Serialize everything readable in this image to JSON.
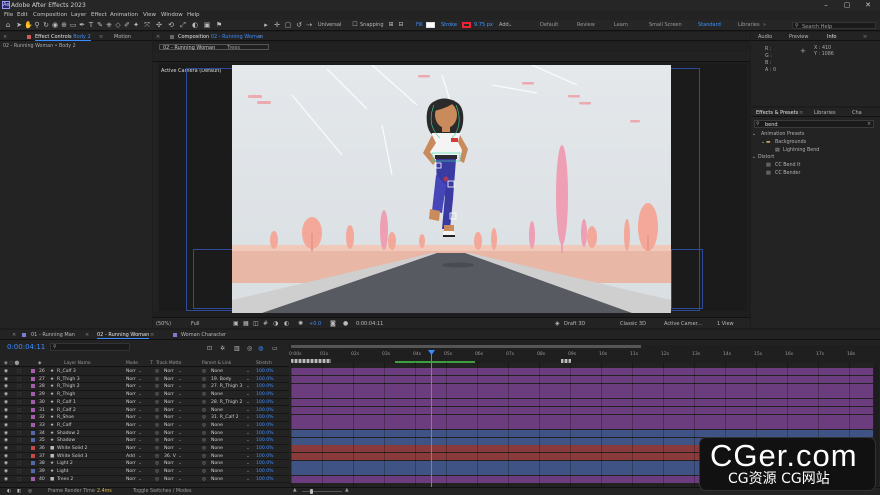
{
  "app": {
    "title": "Adobe After Effects 2023",
    "icon": "Ae"
  },
  "menu": [
    "File",
    "Edit",
    "Composition",
    "Layer",
    "Effect",
    "Animation",
    "View",
    "Window",
    "Help"
  ],
  "toolbar": {
    "universal": "Universal",
    "snapping": "Snapping",
    "fill": "Fill",
    "stroke": "Stroke",
    "stroke_width": "9.75 px",
    "add": "Add"
  },
  "workspaces": [
    "Default",
    "Review",
    "Learn",
    "Small Screen",
    "Standard",
    "Libraries"
  ],
  "search_help": "Search Help",
  "effect_controls": {
    "tab": "Effect Controls",
    "layer": "Body 2",
    "other_tab": "Motion",
    "subtitle": "02 - Running Woman • Body 2"
  },
  "composition_panel": {
    "tab": "Composition",
    "name": "02 - Running Woman",
    "breadcrumb_current": "02 - Running Woman",
    "breadcrumb_next": "Trees",
    "camera_label": "Active Camera (Default)",
    "zoom": "(50%)",
    "resolution": "Full",
    "exposure": "+0.0",
    "timecode": "0:00:04:11",
    "renderer": "Draft 3D",
    "renderer_mode": "Classic 3D",
    "camera_select": "Active Camer...",
    "views": "1 View"
  },
  "info_panel": {
    "tabs": [
      "Audio",
      "Preview",
      "Info"
    ],
    "r": "R :",
    "g": "G :",
    "b": "B :",
    "a": "A : 0",
    "x": "X : 410",
    "y": "Y : 1086"
  },
  "effects_panel": {
    "tabs": [
      "Effects & Presets",
      "Libraries",
      "Cha"
    ],
    "search": "bend",
    "items": [
      {
        "label": "Animation Presets",
        "indent": 0
      },
      {
        "label": "Backgrounds",
        "indent": 1
      },
      {
        "label": "Lightning Bend",
        "indent": 2
      },
      {
        "label": "Distort",
        "indent": 0
      },
      {
        "label": "CC Bend It",
        "indent": 1
      },
      {
        "label": "CC Bender",
        "indent": 1
      }
    ]
  },
  "timeline": {
    "tabs": [
      "01 - Running Man",
      "02 - Running Woman",
      "Woman Character"
    ],
    "timecode": "0:00:04:11",
    "headers": {
      "layer_name": "Layer Name",
      "mode": "Mode",
      "t": "T",
      "track_matte": "Track Matte",
      "parent": "Parent & Link",
      "stretch": "Stretch"
    },
    "ruler": [
      "0:00s",
      "01s",
      "02s",
      "03s",
      "04s",
      "05s",
      "06s",
      "07s",
      "08s",
      "09s",
      "10s",
      "11s",
      "12s",
      "13s",
      "14s",
      "15s",
      "16s",
      "17s",
      "18s"
    ],
    "layers": [
      {
        "num": "26",
        "name": "R_Calf 3",
        "star": true,
        "mode": "Norr",
        "matte": "Norr",
        "parent": "None",
        "stretch": "100.0%",
        "color": "#a25ea8",
        "bar": "#6b3c7e"
      },
      {
        "num": "27",
        "name": "R_Thigh 3",
        "star": true,
        "mode": "Norr",
        "matte": "Norr",
        "parent": "19. Body",
        "stretch": "100.0%",
        "color": "#a25ea8",
        "bar": "#6b3c7e"
      },
      {
        "num": "28",
        "name": "R_Thigh 2",
        "star": true,
        "mode": "Norr",
        "matte": "Norr",
        "parent": "27. R_Thigh 3",
        "stretch": "100.0%",
        "color": "#a25ea8",
        "bar": "#6b3c7e"
      },
      {
        "num": "29",
        "name": "R_Thigh",
        "star": true,
        "mode": "Norr",
        "matte": "Norr",
        "parent": "None",
        "stretch": "100.0%",
        "color": "#a25ea8",
        "bar": "#6b3c7e"
      },
      {
        "num": "30",
        "name": "R_Calf 1",
        "star": true,
        "mode": "Norr",
        "matte": "Norr",
        "parent": "28. R_Thigh 2",
        "stretch": "100.0%",
        "color": "#a25ea8",
        "bar": "#6b3c7e"
      },
      {
        "num": "31",
        "name": "R_Calf 2",
        "star": true,
        "mode": "Norr",
        "matte": "Norr",
        "parent": "None",
        "stretch": "100.0%",
        "color": "#a25ea8",
        "bar": "#6b3c7e"
      },
      {
        "num": "32",
        "name": "R_Shoe",
        "star": true,
        "mode": "Norr",
        "matte": "Norr",
        "parent": "31. R_Calf 2",
        "stretch": "100.0%",
        "color": "#a25ea8",
        "bar": "#6b3c7e"
      },
      {
        "num": "33",
        "name": "R_Calf",
        "star": true,
        "mode": "Norr",
        "matte": "Norr",
        "parent": "None",
        "stretch": "100.0%",
        "color": "#a25ea8",
        "bar": "#6b3c7e"
      },
      {
        "num": "34",
        "name": "Shadow 2",
        "star": true,
        "mode": "Norr",
        "matte": "Norr",
        "parent": "None",
        "stretch": "100.0%",
        "color": "#5468a8",
        "bar": "#3f5384"
      },
      {
        "num": "35",
        "name": "Shadow",
        "star": true,
        "mode": "Norr",
        "matte": "Norr",
        "parent": "None",
        "stretch": "100.0%",
        "color": "#5468a8",
        "bar": "#3f5384"
      },
      {
        "num": "36",
        "name": "White Solid 2",
        "star": false,
        "mode": "Norr",
        "matte": "Norr",
        "parent": "None",
        "stretch": "100.0%",
        "color": "#c24a4a",
        "bar": "#8a3a3a"
      },
      {
        "num": "37",
        "name": "White Solid 3",
        "star": false,
        "mode": "Add",
        "matte": "36. V",
        "parent": "None",
        "stretch": "100.0%",
        "color": "#c24a4a",
        "bar": "#8a3a3a"
      },
      {
        "num": "38",
        "name": "Light 2",
        "star": true,
        "mode": "Norr",
        "matte": "Norr",
        "parent": "None",
        "stretch": "100.0%",
        "color": "#5468a8",
        "bar": "#3f5384"
      },
      {
        "num": "39",
        "name": "Light",
        "star": true,
        "mode": "Norr",
        "matte": "Norr",
        "parent": "None",
        "stretch": "100.0%",
        "color": "#5468a8",
        "bar": "#3f5384"
      },
      {
        "num": "40",
        "name": "Trees 2",
        "star": false,
        "mode": "Norr",
        "matte": "Norr",
        "parent": "None",
        "stretch": "100.0%",
        "color": "#a25ea8",
        "bar": "#6b3c7e"
      }
    ],
    "footer": {
      "render_label": "Frame Render Time",
      "render_value": "2.4ms",
      "toggle": "Toggle Switches / Modes"
    }
  },
  "watermark": {
    "line1": "CGer.com",
    "line2": "CG资源 CG网站"
  }
}
